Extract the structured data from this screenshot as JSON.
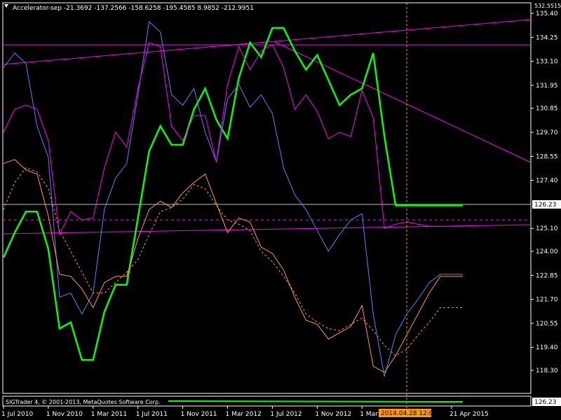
{
  "indicator_title": "Accelerator-sep -21.3692 -137.2566 -158.6258 -195.4585 8.9852 -212.9951",
  "sub_window_label": "SIGTrader 4, © 2001-2013, MetaQuotes Software Corp.",
  "colors": {
    "background": "#000000",
    "frame": "#ffffff",
    "green": "#00ff00",
    "blue": "#6a7cff",
    "magenta": "#ff00ff",
    "orange": "#ffa020",
    "highlight_box": "#ff9a00"
  },
  "chart_data": {
    "type": "line",
    "title": "Accelerator-sep -21.3692 -137.2566 -158.6258 -195.4585 8.9852 -212.9951",
    "x_tick_labels": [
      "1 Jul 2010",
      "1 Nov 2010",
      "1 Mar 2011",
      "1 Jul 2011",
      "1 Nov 2011",
      "1 Mar 2012",
      "1 Jul 2012",
      "1 Nov 2012",
      "1 Mar",
      "21 Apr 2015"
    ],
    "x_tick_index": [
      0,
      4,
      8,
      12,
      16,
      20,
      24,
      28,
      32,
      40
    ],
    "y_tick_labels": [
      "135.40",
      "134.25",
      "133.10",
      "131.95",
      "130.85",
      "129.70",
      "128.55",
      "127.40",
      "126.23",
      "125.10",
      "124.00",
      "122.85",
      "121.70",
      "120.55",
      "119.40",
      "118.30"
    ],
    "y_top_label": "532.5515",
    "ylim": [
      117.55,
      135.85
    ],
    "current_price_label": "126.23",
    "crosshair_label": "2014.04.28 12:00",
    "crosshair_index": 34.75,
    "series": [
      {
        "color": "#00ff00",
        "width": 2.5,
        "values": [
          123.7,
          124.9,
          125.9,
          125.9,
          124.1,
          120.3,
          120.6,
          118.8,
          118.8,
          121.1,
          122.4,
          122.4,
          125.6,
          128.8,
          130.0,
          129.1,
          129.1,
          130.8,
          131.8,
          130.3,
          129.4,
          132.3,
          134.0,
          133.3,
          134.7,
          134.7,
          133.6,
          132.7,
          133.4,
          132.2,
          131.0,
          131.5,
          131.8,
          133.5,
          129.5,
          126.2,
          126.2,
          126.2,
          126.2,
          126.2,
          126.2,
          126.2
        ]
      },
      {
        "color": "#6a7cff",
        "width": 1,
        "values": [
          132.8,
          133.5,
          133.0,
          130.0,
          128.5,
          121.8,
          122.0,
          121.0,
          122.0,
          126.0,
          127.5,
          128.2,
          131.5,
          135.0,
          134.5,
          131.5,
          131.0,
          131.8,
          129.7,
          128.3,
          131.3,
          132.0,
          130.9,
          131.5,
          130.6,
          128.0,
          126.7,
          126.0,
          125.0,
          124.0,
          124.8,
          125.5,
          125.8,
          121.0,
          118.0,
          120.0,
          121.0,
          121.7,
          122.5,
          122.9,
          122.9,
          122.9
        ]
      },
      {
        "color": "#ff00ff",
        "width": 1,
        "values": [
          129.7,
          130.8,
          131.0,
          130.8,
          129.3,
          124.8,
          125.9,
          125.5,
          125.6,
          128.0,
          129.7,
          129.0,
          131.8,
          134.0,
          133.8,
          130.0,
          129.3,
          130.5,
          130.5,
          128.3,
          132.0,
          133.8,
          132.7,
          133.6,
          133.9,
          132.8,
          130.8,
          131.5,
          130.7,
          129.4,
          129.7,
          129.5,
          131.7,
          130.4,
          125.1,
          125.3,
          125.4,
          125.3,
          125.2,
          125.2,
          125.2,
          125.2
        ]
      },
      {
        "color": "#ffa020",
        "width": 1,
        "values": [
          128.2,
          128.4,
          127.9,
          127.7,
          125.7,
          122.9,
          122.8,
          122.2,
          121.3,
          122.5,
          122.8,
          122.8,
          124.6,
          126.0,
          126.4,
          126.1,
          126.8,
          127.3,
          127.7,
          126.3,
          124.9,
          125.6,
          125.4,
          124.2,
          123.9,
          123.1,
          121.8,
          120.7,
          120.5,
          119.8,
          120.1,
          120.4,
          121.4,
          118.5,
          118.2,
          119.0,
          120.0,
          121.0,
          122.0,
          122.8,
          122.8,
          122.8
        ]
      },
      {
        "color": "#ffa020",
        "width": 1,
        "dash": "3,3",
        "values": [
          126.0,
          127.3,
          128.0,
          127.8,
          127.0,
          125.0,
          124.0,
          123.0,
          122.0,
          122.0,
          122.5,
          123.0,
          123.6,
          124.8,
          125.9,
          126.1,
          126.5,
          127.2,
          127.0,
          126.2,
          125.5,
          125.3,
          125.0,
          124.0,
          123.5,
          122.8,
          122.0,
          121.0,
          120.6,
          120.3,
          120.2,
          120.5,
          120.8,
          120.2,
          119.5,
          119.0,
          119.3,
          120.0,
          120.6,
          121.3,
          121.3,
          121.3
        ]
      }
    ]
  }
}
